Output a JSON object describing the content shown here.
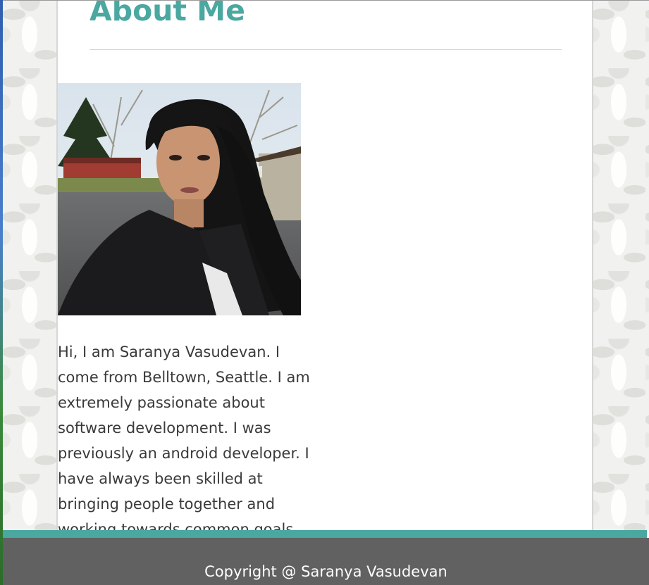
{
  "page": {
    "title": "About Me",
    "accent_color": "#4aa8a0",
    "footer_color": "#616161"
  },
  "profile": {
    "photo_alt": "Photo of Saranya Vasudevan",
    "bio": "Hi, I am Saranya Vasudevan. I come from Belltown, Seattle. I am extremely passionate about software development. I was previously an android developer. I have always been skilled at bringing people together and working towards common goals."
  },
  "footer": {
    "copyright": "Copyright @ Saranya Vasudevan"
  }
}
